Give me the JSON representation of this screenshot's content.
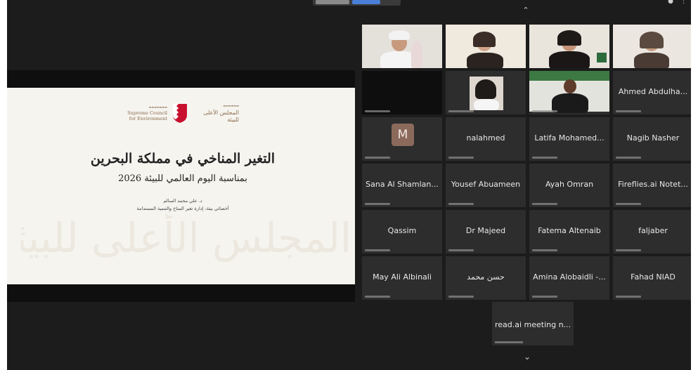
{
  "slide": {
    "title": "التغير المناخي في مملكة البحرين",
    "subtitle": "بمناسبة اليوم العالمي للبيئة 2026",
    "presenter_name": "د. علي محمد السالم",
    "presenter_role": "أخصائي بيئة، إدارة تغير المناخ والتنمية المستدامة",
    "council_en_line1": "Supreme Council",
    "council_en_line2": "for Environment",
    "council_ar": "المجلس الأعلى للبيئة",
    "watermark": "المجلس الأعلى للبيئة"
  },
  "participants": [
    {
      "name": "",
      "kind": "video"
    },
    {
      "name": "",
      "kind": "video"
    },
    {
      "name": "",
      "kind": "video"
    },
    {
      "name": "",
      "kind": "video"
    },
    {
      "name": "",
      "kind": "dark"
    },
    {
      "name": "",
      "kind": "video"
    },
    {
      "name": "",
      "kind": "video"
    },
    {
      "name": "Ahmed Abdulha...",
      "kind": "name"
    },
    {
      "name": "",
      "kind": "avatar",
      "initial": "M"
    },
    {
      "name": "nalahmed",
      "kind": "name"
    },
    {
      "name": "Latifa Mohamed...",
      "kind": "name"
    },
    {
      "name": "Nagib Nasher",
      "kind": "name"
    },
    {
      "name": "Sana Al Shamlan...",
      "kind": "name"
    },
    {
      "name": "Yousef Abuameen",
      "kind": "name"
    },
    {
      "name": "Ayah Omran",
      "kind": "name"
    },
    {
      "name": "Fireflies.ai Notet...",
      "kind": "name"
    },
    {
      "name": "Qassim",
      "kind": "name"
    },
    {
      "name": "Dr Majeed",
      "kind": "name"
    },
    {
      "name": "Fatema Altenaib",
      "kind": "name"
    },
    {
      "name": "faljaber",
      "kind": "name"
    },
    {
      "name": "May Ali Albinali",
      "kind": "name"
    },
    {
      "name": "حسن محمد",
      "kind": "name"
    },
    {
      "name": "Amina Alobaidli -...",
      "kind": "name"
    },
    {
      "name": "Fahad NIAD",
      "kind": "name"
    }
  ],
  "overflow_participant": {
    "name": "read.ai meeting n..."
  },
  "colors": {
    "background": "#1c1c1c",
    "tile": "#2d2d2d",
    "slide": "#f6f4ef",
    "accent_blue": "#4a7fd8"
  }
}
